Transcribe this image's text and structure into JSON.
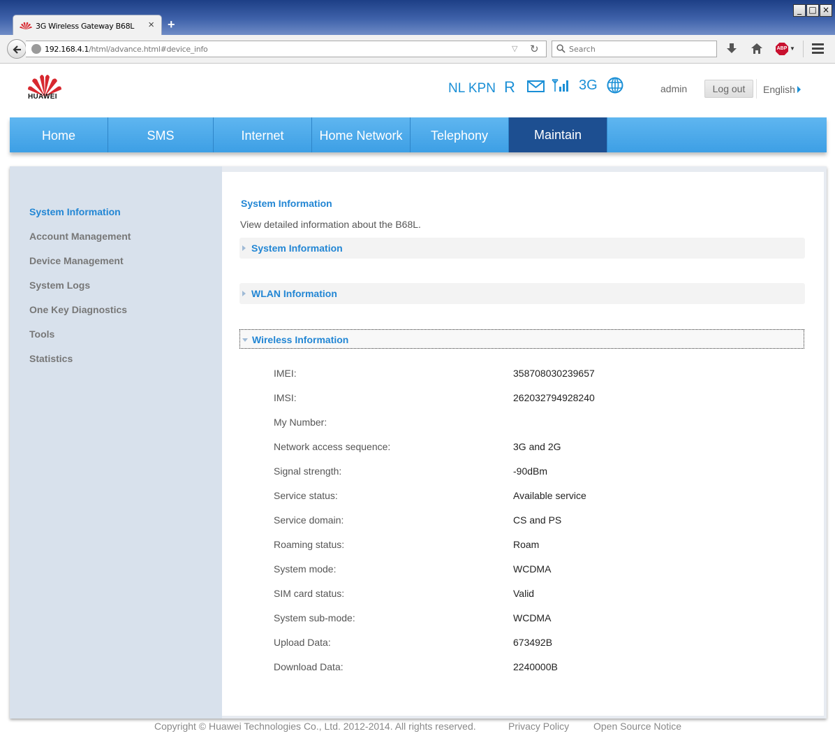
{
  "browser": {
    "tab_title": "3G Wireless Gateway B68L",
    "tab_close": "×",
    "new_tab": "+",
    "url_host": "192.168.4.1",
    "url_path": "/html/advance.html#device_info",
    "search_placeholder": "Search",
    "abp_label": "ABP"
  },
  "header": {
    "brand": "HUAWEI",
    "operator": "NL KPN",
    "roaming_indicator": "R",
    "network_type": "3G",
    "user": "admin",
    "logout_label": "Log out",
    "language": "English",
    "brand_color": "#1a8fd6"
  },
  "menu": {
    "items": [
      {
        "label": "Home"
      },
      {
        "label": "SMS"
      },
      {
        "label": "Internet"
      },
      {
        "label": "Home Network"
      },
      {
        "label": "Telephony"
      },
      {
        "label": "Maintain"
      }
    ],
    "active": "Maintain"
  },
  "sidebar": {
    "items": [
      {
        "label": "System Information"
      },
      {
        "label": "Account Management"
      },
      {
        "label": "Device Management"
      },
      {
        "label": "System Logs"
      },
      {
        "label": "One Key Diagnostics"
      },
      {
        "label": "Tools"
      },
      {
        "label": "Statistics"
      }
    ],
    "active": "System Information"
  },
  "main": {
    "title": "System Information",
    "description": "View detailed information about the B68L.",
    "sections": [
      {
        "label": "System Information",
        "expanded": false
      },
      {
        "label": "WLAN Information",
        "expanded": false
      },
      {
        "label": "Wireless Information",
        "expanded": true
      }
    ],
    "wireless_info": [
      {
        "label": "IMEI:",
        "value": "358708030239657"
      },
      {
        "label": "IMSI:",
        "value": "262032794928240"
      },
      {
        "label": "My Number:",
        "value": ""
      },
      {
        "label": "Network access sequence:",
        "value": "3G and 2G"
      },
      {
        "label": "Signal strength:",
        "value": "-90dBm"
      },
      {
        "label": "Service status:",
        "value": "Available service"
      },
      {
        "label": "Service domain:",
        "value": "CS and PS"
      },
      {
        "label": "Roaming status:",
        "value": "Roam"
      },
      {
        "label": "System mode:",
        "value": "WCDMA"
      },
      {
        "label": "SIM card status:",
        "value": "Valid"
      },
      {
        "label": "System sub-mode:",
        "value": "WCDMA"
      },
      {
        "label": "Upload Data:",
        "value": "673492B"
      },
      {
        "label": "Download Data:",
        "value": "2240000B"
      }
    ]
  },
  "footer": {
    "copyright": "Copyright © Huawei Technologies Co., Ltd. 2012-2014. All rights reserved.",
    "privacy": "Privacy Policy",
    "open_source": "Open Source Notice"
  }
}
